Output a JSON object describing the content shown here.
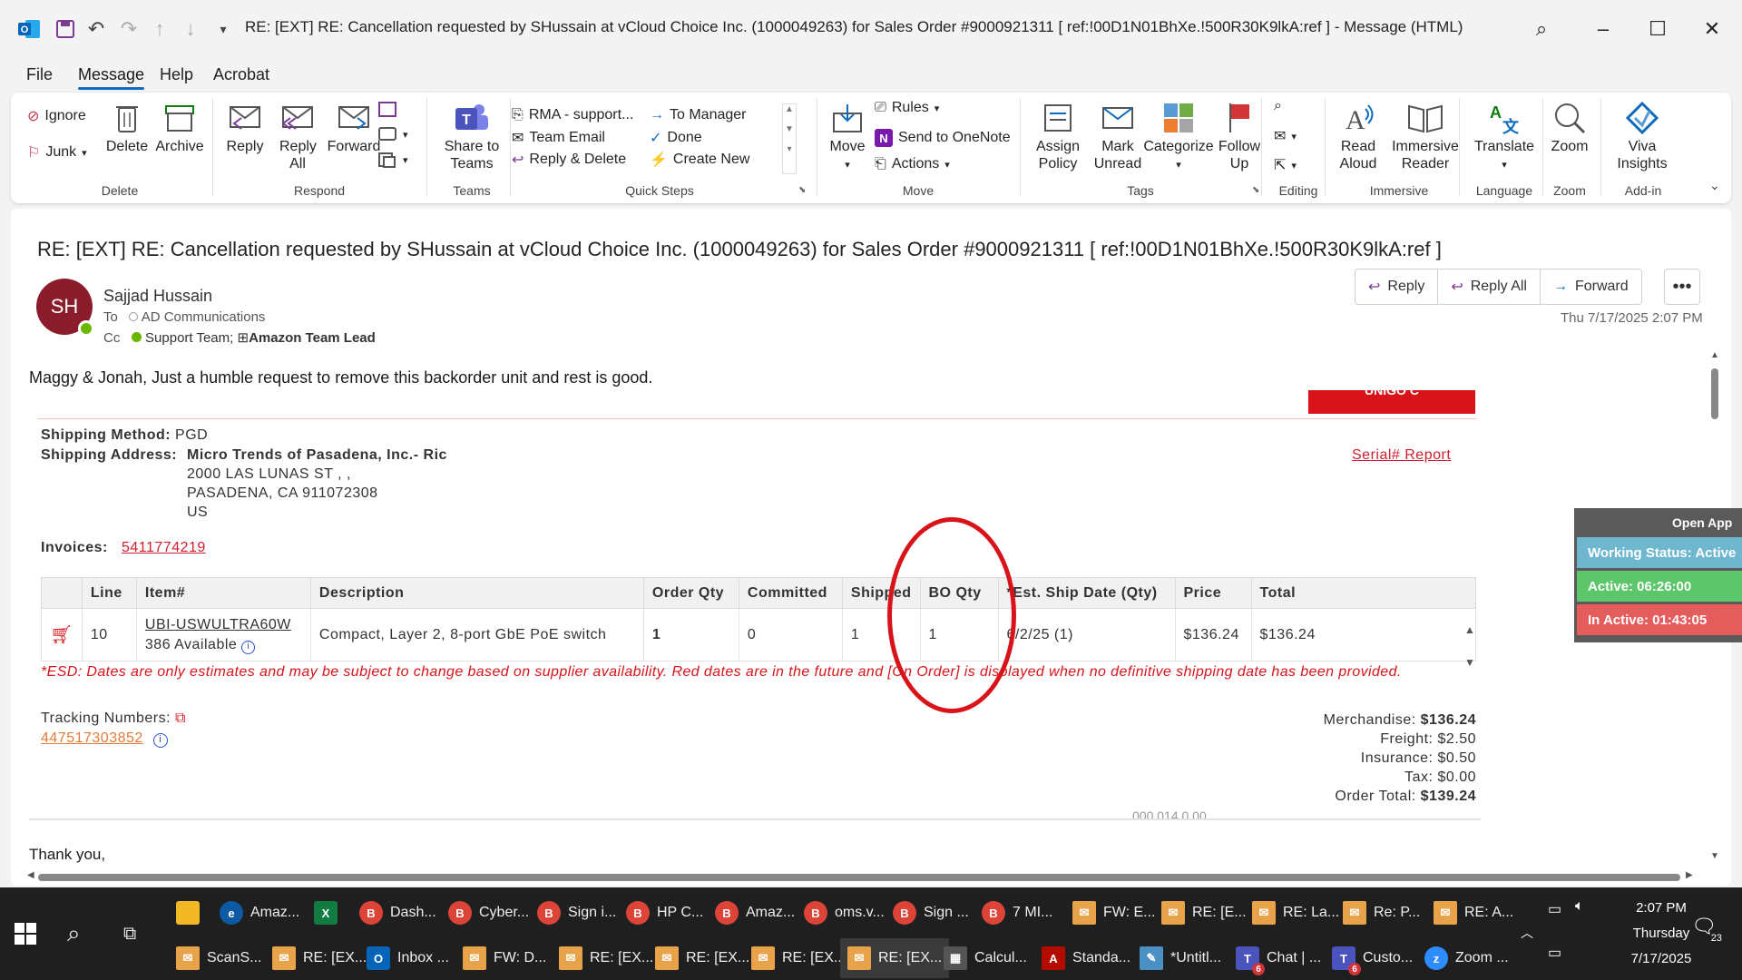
{
  "window": {
    "title": "RE: [EXT] RE: Cancellation requested by SHussain at vCloud Choice Inc. (1000049263) for Sales Order #9000921311    [ ref:!00D1N01BhXe.!500R30K9lkA:ref ]  -  Message (HTML)"
  },
  "menu": {
    "file": "File",
    "message": "Message",
    "help": "Help",
    "acrobat": "Acrobat"
  },
  "ribbon": {
    "ignore": "Ignore",
    "junk": "Junk",
    "delete": "Delete",
    "archive": "Archive",
    "group_delete": "Delete",
    "reply": "Reply",
    "reply_all": "Reply All",
    "forward": "Forward",
    "group_respond": "Respond",
    "share_teams": "Share to Teams",
    "group_teams": "Teams",
    "qs_rma": "RMA - support...",
    "qs_team_email": "Team Email",
    "qs_reply_delete": "Reply & Delete",
    "qs_to_manager": "To Manager",
    "qs_done": "Done",
    "qs_create_new": "Create New",
    "group_quicksteps": "Quick Steps",
    "move": "Move",
    "rules": "Rules",
    "send_onenote": "Send to OneNote",
    "actions": "Actions",
    "group_move": "Move",
    "assign_policy": "Assign Policy",
    "mark_unread": "Mark Unread",
    "categorize": "Categorize",
    "follow_up": "Follow Up",
    "group_tags": "Tags",
    "group_editing": "Editing",
    "read_aloud": "Read Aloud",
    "immersive_reader": "Immersive Reader",
    "group_immersive": "Immersive",
    "translate": "Translate",
    "group_language": "Language",
    "zoom": "Zoom",
    "group_zoom": "Zoom",
    "viva": "Viva Insights",
    "group_addin": "Add-in"
  },
  "message": {
    "subject": "RE: [EXT] RE: Cancellation requested by SHussain at vCloud Choice Inc. (1000049263) for Sales Order #9000921311     [ ref:!00D1N01BhXe.!500R30K9lkA:ref ]",
    "avatar_initials": "SH",
    "sender": "Sajjad Hussain",
    "to_label": "To",
    "to_value": "AD Communications",
    "cc_label": "Cc",
    "cc_1": "Support Team;",
    "cc_2": "Amazon Team Lead",
    "reply": "Reply",
    "reply_all": "Reply All",
    "forward": "Forward",
    "more": "•••",
    "datetime": "Thu 7/17/2025 2:07 PM",
    "body_line": "Maggy & Jonah, Just a humble request to remove this backorder unit and rest is good.",
    "banner_text": "UNIGO C"
  },
  "order": {
    "shipping_method_label": "Shipping Method:",
    "shipping_method": "PGD",
    "shipping_address_label": "Shipping Address:",
    "address_name": "Micro Trends of Pasadena, Inc.- Ric",
    "address_line1": "2000 LAS LUNAS ST , ,",
    "address_line2": "PASADENA, CA 911072308",
    "address_line3": "US",
    "serial_report": "Serial# Report",
    "invoices_label": "Invoices:",
    "invoice_number": "5411774219",
    "columns": [
      "",
      "Line",
      "Item#",
      "Description",
      "Order Qty",
      "Committed",
      "Shipped",
      "BO Qty",
      "*Est. Ship Date (Qty)",
      "Price",
      "Total"
    ],
    "row": {
      "line": "10",
      "item": "UBI-USWULTRA60W",
      "available": "386 Available",
      "description": "Compact, Layer 2, 8-port GbE PoE switch",
      "order_qty": "1",
      "committed": "0",
      "shipped": "1",
      "bo_qty": "1",
      "est_ship": "6/2/25 (1)",
      "price": "$136.24",
      "total": "$136.24"
    },
    "esd_note": "*ESD: Dates are only estimates and may be subject to change based on supplier availability. Red dates are in the future and [On Order] is displayed when no definitive shipping date has been provided.",
    "tracking_label": "Tracking Numbers:",
    "tracking_number": "447517303852",
    "merch_label": "Merchandise:",
    "merch": "$136.24",
    "freight_label": "Freight:",
    "freight": "$2.50",
    "insurance_label": "Insurance:",
    "insurance": "$0.50",
    "tax_label": "Tax:",
    "tax": "$0.00",
    "total_label": "Order Total:",
    "total": "$139.24",
    "cutoff_text": "000 014 0.00"
  },
  "closing": "Thank you,",
  "widget": {
    "open_app": "Open App",
    "working_status": "Working Status: Active",
    "active": "Active: 06:26:00",
    "inactive": "In Active: 01:43:05"
  },
  "taskbar": {
    "row1": [
      "Amaz...",
      "",
      "Dash...",
      "Cyber...",
      "Sign i...",
      "HP C...",
      "Amaz...",
      "oms.v...",
      "Sign ...",
      "7 MI...",
      "FW: E...",
      "RE: [E...",
      "RE: La...",
      "Re: P...",
      "RE: A..."
    ],
    "row2": [
      "ScanS...",
      "RE: [EX...",
      "Inbox ...",
      "FW: D...",
      "RE: [EX...",
      "RE: [EX...",
      "RE: [EX...",
      "RE: [EX...",
      "Calcul...",
      "Standa...",
      "*Untitl...",
      "Chat | ...",
      "Custo...",
      "Zoom ..."
    ],
    "time": "2:07 PM",
    "day": "Thursday",
    "date": "7/17/2025",
    "notif_count": "23",
    "badge_6": "6"
  }
}
